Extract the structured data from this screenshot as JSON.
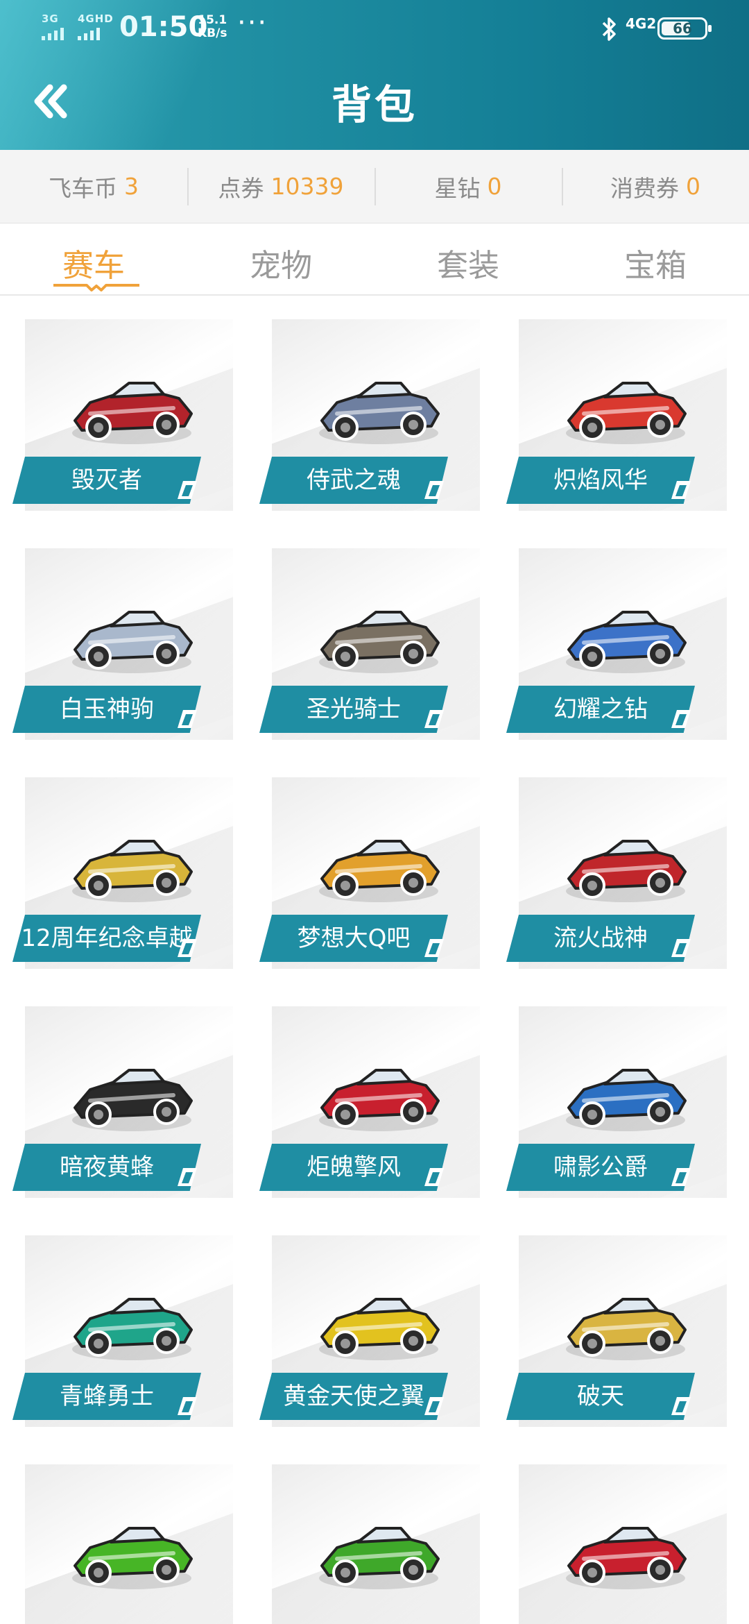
{
  "status_bar": {
    "network_1": "3G",
    "network_2": "4GHD",
    "time": "01:50",
    "speed_value": "15.1",
    "speed_unit": "KB/s",
    "more": "···",
    "network_right": "4G2",
    "battery": "66"
  },
  "header": {
    "title": "背包",
    "back_icon": "double-chevron-left-icon"
  },
  "currencies": [
    {
      "label": "飞车币",
      "value": "3"
    },
    {
      "label": "点券",
      "value": "10339"
    },
    {
      "label": "星钻",
      "value": "0"
    },
    {
      "label": "消费券",
      "value": "0"
    }
  ],
  "tabs": [
    {
      "label": "赛车",
      "active": true
    },
    {
      "label": "宠物",
      "active": false
    },
    {
      "label": "套装",
      "active": false
    },
    {
      "label": "宝箱",
      "active": false
    }
  ],
  "colors": {
    "accent": "#f0a23a",
    "plate": "#1f8ea3",
    "header": "#1b8ca0"
  },
  "items": [
    {
      "name": "毁灭者",
      "color": "#b2232b"
    },
    {
      "name": "侍武之魂",
      "color": "#6e7fa0"
    },
    {
      "name": "炽焰风华",
      "color": "#d9392f"
    },
    {
      "name": "白玉神驹",
      "color": "#a9b8cc"
    },
    {
      "name": "圣光骑士",
      "color": "#7a7062"
    },
    {
      "name": "幻耀之钻",
      "color": "#3c72c8"
    },
    {
      "name": "12周年纪念卓越",
      "color": "#d8b53a"
    },
    {
      "name": "梦想大Q吧",
      "color": "#e2a02c"
    },
    {
      "name": "流火战神",
      "color": "#c0262b"
    },
    {
      "name": "暗夜黄蜂",
      "color": "#2a2a2a"
    },
    {
      "name": "炬魄擎风",
      "color": "#c8202e"
    },
    {
      "name": "啸影公爵",
      "color": "#2b6fc2"
    },
    {
      "name": "青蜂勇士",
      "color": "#1fa58a"
    },
    {
      "name": "黄金天使之翼",
      "color": "#e2c21f"
    },
    {
      "name": "破天",
      "color": "#d9b441"
    },
    {
      "name": "",
      "color": "#47b526"
    },
    {
      "name": "",
      "color": "#3fa82a"
    },
    {
      "name": "",
      "color": "#c8202e"
    }
  ]
}
